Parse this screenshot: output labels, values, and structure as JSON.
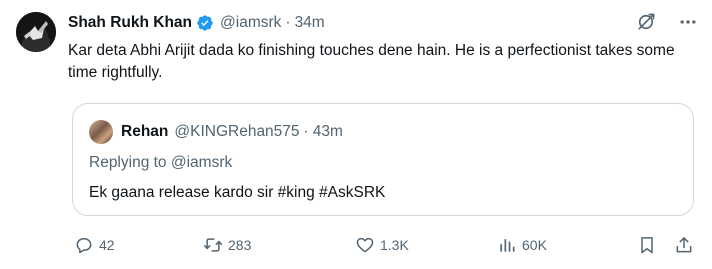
{
  "tweet": {
    "author_name": "Shah Rukh Khan",
    "handle": "@iamsrk",
    "separator": "·",
    "time": "34m",
    "text": "Kar deta Abhi Arijit dada ko finishing touches dene hain. He is a perfectionist takes some time rightfully."
  },
  "quote": {
    "author_name": "Rehan",
    "handle": "@KINGRehan575",
    "separator": "·",
    "time": "43m",
    "replying_label": "Replying to",
    "replying_handle": "@iamsrk",
    "text": "Ek gaana release kardo sir #king #AskSRK"
  },
  "actions": {
    "replies": "42",
    "reposts": "283",
    "likes": "1.3K",
    "views": "60K"
  },
  "icons": {
    "verified": "verified-badge-icon",
    "grok": "grok-icon",
    "more": "more-icon",
    "reply": "reply-icon",
    "repost": "repost-icon",
    "like": "like-icon",
    "views": "views-icon",
    "bookmark": "bookmark-icon",
    "share": "share-icon"
  },
  "colors": {
    "text": "#0f1419",
    "secondary": "#536471",
    "verified": "#1d9bf0",
    "border": "#cfd9de"
  }
}
